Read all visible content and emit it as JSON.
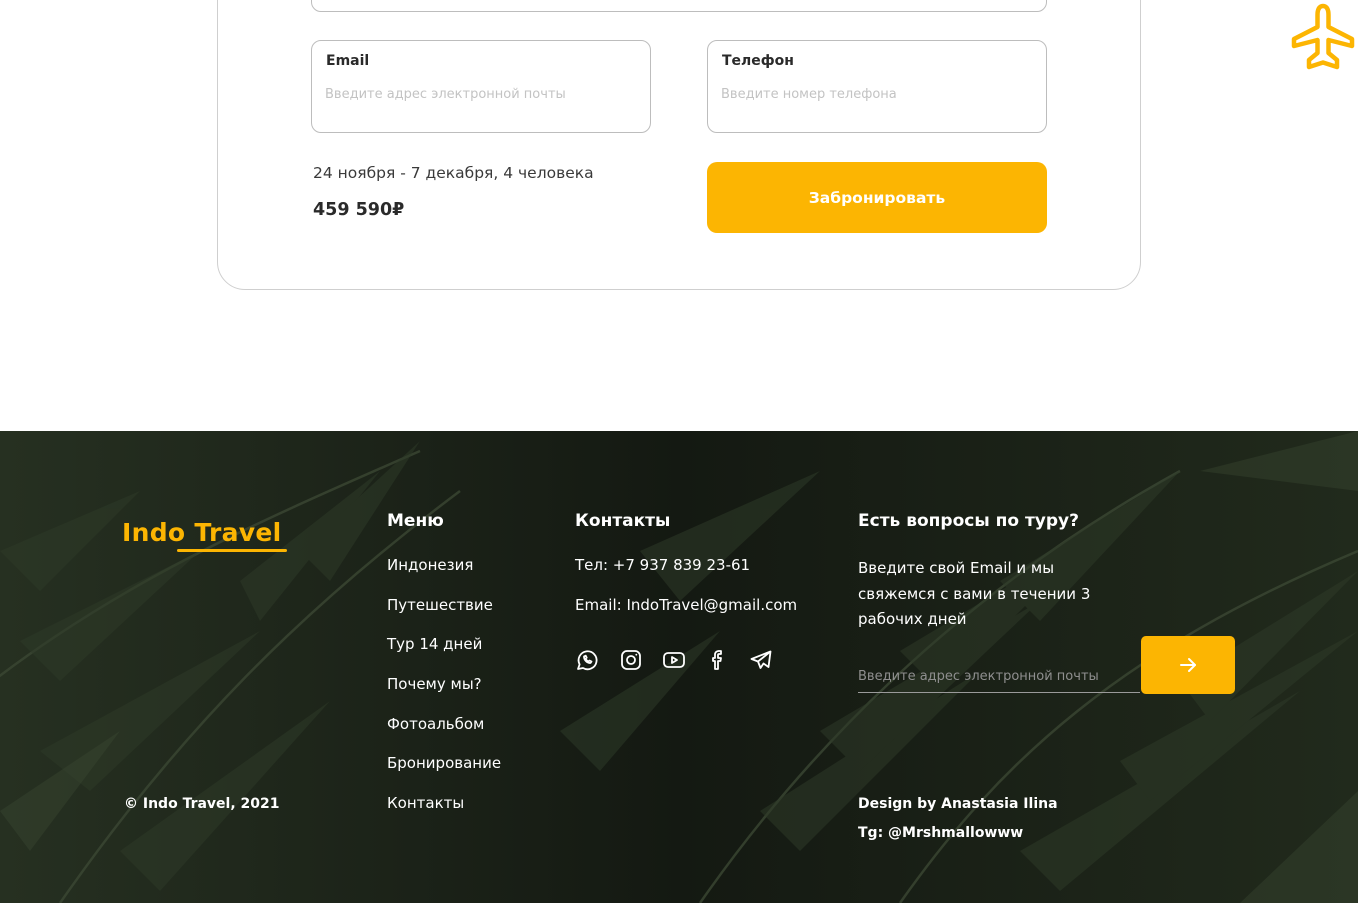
{
  "booking": {
    "email_label": "Email",
    "email_placeholder": "Введите адрес электронной почты",
    "phone_label": "Телефон",
    "phone_placeholder": "Введите номер телефона",
    "dates": "24 ноября - 7 декабря, 4 человека",
    "price": "459 590₽",
    "submit_label": "Забронировать"
  },
  "header": {
    "plane_icon": "airplane-icon"
  },
  "colors": {
    "accent": "#fcb502",
    "footer_bg": "#1a2016",
    "card_border": "#cfcfcf"
  },
  "footer": {
    "logo": "Indo Travel",
    "copyright": "© Indo Travel, 2021",
    "menu": {
      "title": "Меню",
      "items": [
        {
          "label": "Индонезия"
        },
        {
          "label": "Путешествие"
        },
        {
          "label": "Тур 14 дней"
        },
        {
          "label": "Почему мы?"
        },
        {
          "label": "Фотоальбом"
        },
        {
          "label": "Бронирование"
        },
        {
          "label": "Контакты"
        }
      ]
    },
    "contacts": {
      "title": "Контакты",
      "phone": "Тел: +7 937 839 23-61",
      "email": "Email: IndoTravel@gmail.com",
      "socials": [
        {
          "name": "whatsapp-icon"
        },
        {
          "name": "instagram-icon"
        },
        {
          "name": "youtube-icon"
        },
        {
          "name": "facebook-icon"
        },
        {
          "name": "telegram-icon"
        }
      ]
    },
    "questions": {
      "title": "Есть вопросы по туру?",
      "text": "Введите свой Email и мы свяжемся с вами в течении 3 рабочих дней",
      "email_placeholder": "Введите адрес электронной почты",
      "submit_icon": "arrow-right-icon"
    },
    "credits": {
      "design": "Design by Anastasia Ilina",
      "telegram": "Tg: @Mrshmallowww"
    }
  }
}
